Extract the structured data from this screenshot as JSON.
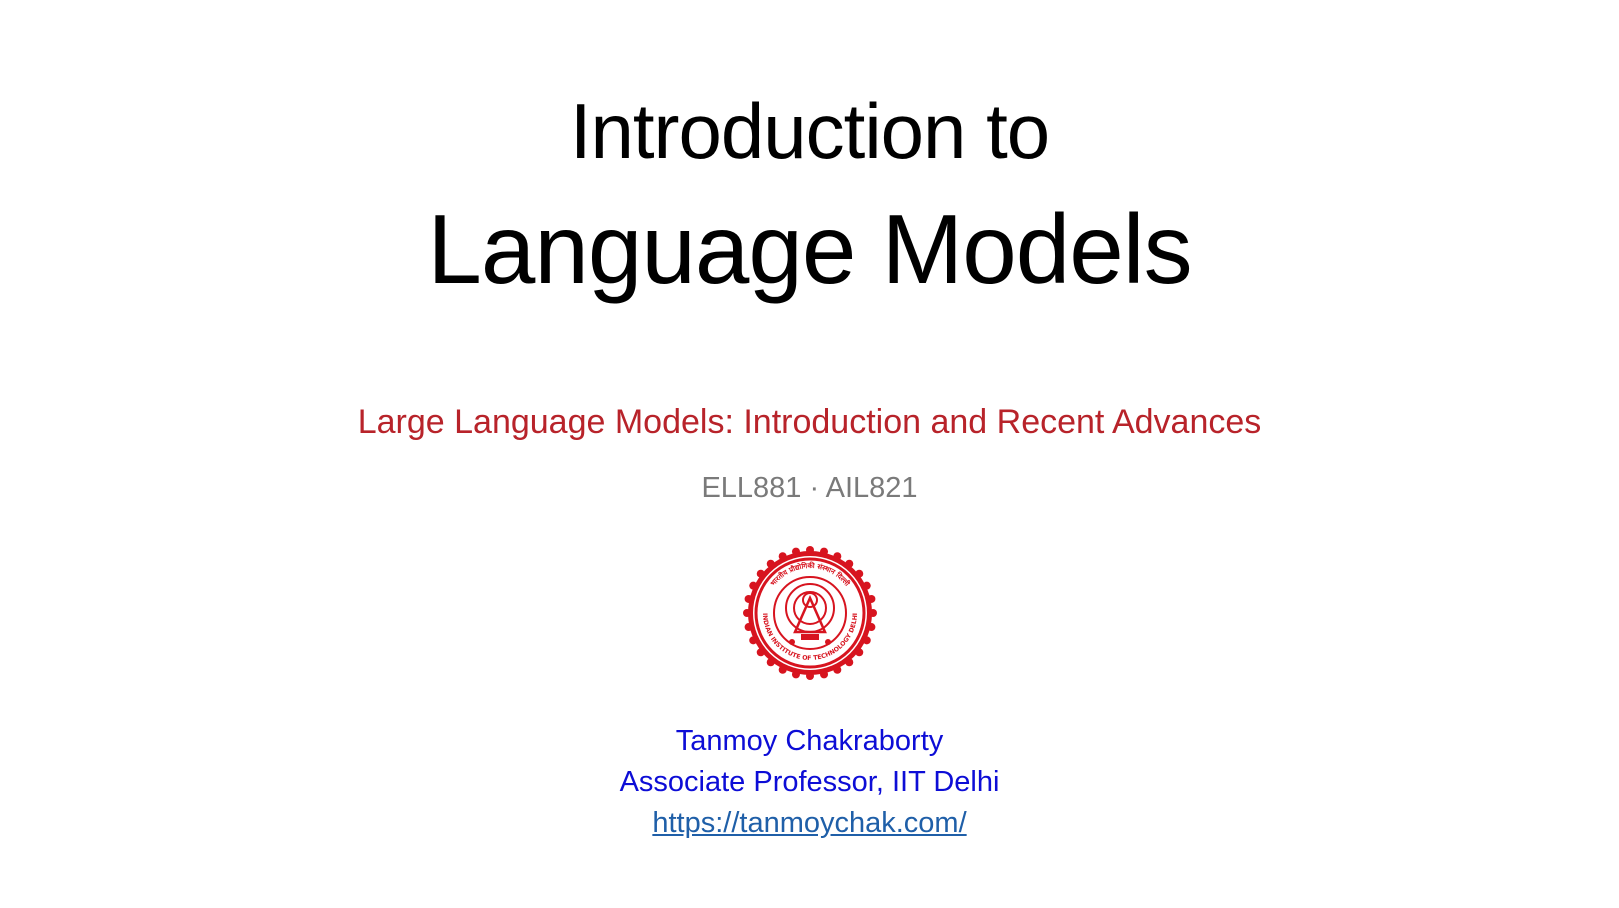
{
  "slide": {
    "title_line1": "Introduction to",
    "title_line2": "Language Models",
    "course_name": "Large Language Models: Introduction and Recent Advances",
    "course_codes": "ELL881 · AIL821",
    "logo": {
      "icon": "iit-delhi-seal-icon",
      "outer_text_top": "भारतीय प्रौद्योगिकी संस्थान दिल्ली",
      "outer_text_bottom": "INDIAN INSTITUTE OF TECHNOLOGY DELHI",
      "color": "#d7141f"
    },
    "author": {
      "name": "Tanmoy Chakraborty",
      "title": "Associate Professor, IIT Delhi",
      "url": "https://tanmoychak.com/"
    }
  },
  "colors": {
    "background": "#ffffff",
    "title": "#000000",
    "course_name": "#b8232a",
    "course_codes": "#7a7a7a",
    "author": "#0d0dd6",
    "link": "#1f5fa8"
  }
}
